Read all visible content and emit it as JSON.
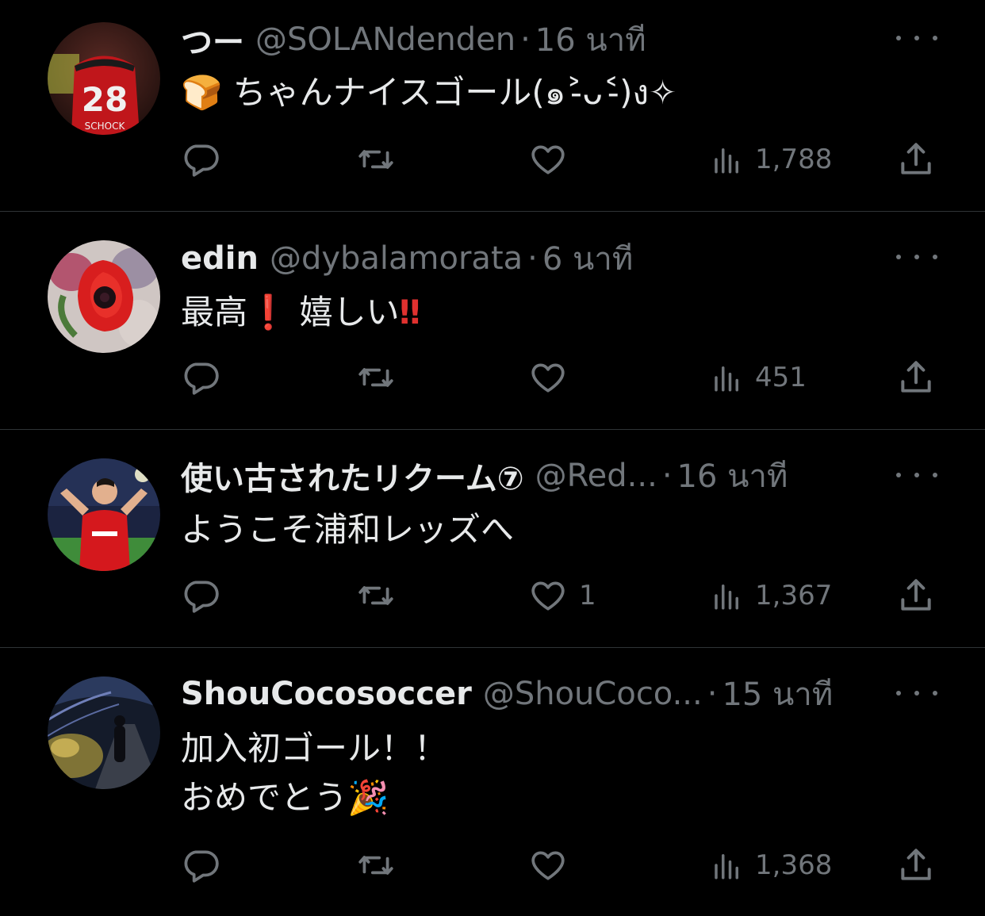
{
  "tweets": [
    {
      "name": "つー",
      "handle": "@SOLANdenden",
      "dot": "·",
      "time": "16 นาที",
      "lines": [
        "🍞 ちゃんナイスゴール(๑˃̵ᴗ˂̵)ง✧"
      ],
      "replies": "",
      "retweets": "",
      "likes": "",
      "views": "1,788",
      "avatar": "soccer-player-28-schock"
    },
    {
      "name": "edin",
      "handle": "@dybalamorata",
      "dot": "·",
      "time": "6 นาที",
      "line_parts": [
        "最高",
        "❗",
        " 嬉しい",
        "‼"
      ],
      "replies": "",
      "retweets": "",
      "likes": "",
      "views": "451",
      "avatar": "red-flower"
    },
    {
      "name": "使い古されたリクーム⑦",
      "handle": "@Red...",
      "dot": "·",
      "time": "16 นาที",
      "lines": [
        "ようこそ浦和レッズへ"
      ],
      "replies": "",
      "retweets": "",
      "likes": "1",
      "views": "1,367",
      "avatar": "celebrating-player"
    },
    {
      "name": "ShouCocosoccer",
      "handle": "@ShouCoco...",
      "dot": "·",
      "time": "15 นาที",
      "lines": [
        "加入初ゴール！！",
        "おめでとう🎉"
      ],
      "replies": "",
      "retweets": "",
      "likes": "",
      "views": "1,368",
      "avatar": "night-walkway"
    }
  ],
  "colors": {
    "background": "#000000",
    "text": "#e7e9ea",
    "muted": "#71767b",
    "divider": "#2f3336",
    "accent_red": "#e0312f"
  },
  "icons": {
    "reply": "reply-icon",
    "retweet": "retweet-icon",
    "like": "heart-icon",
    "views": "views-icon",
    "share": "share-icon",
    "more": "more-icon"
  }
}
